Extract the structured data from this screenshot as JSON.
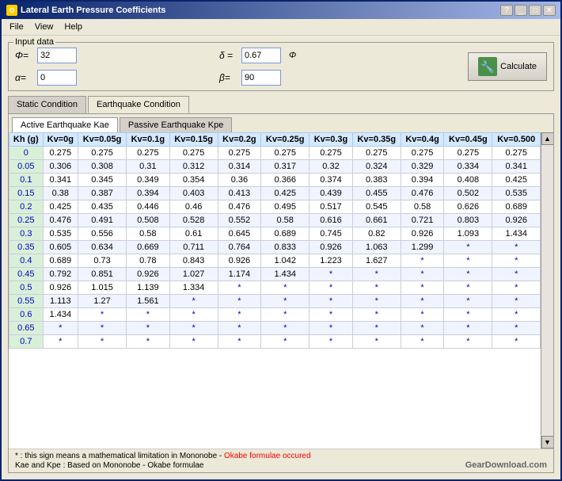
{
  "window": {
    "title": "Lateral Earth Pressure Coefficients",
    "help_btn": "?",
    "close_btn": "✕",
    "minimize_btn": "_",
    "maximize_btn": "□"
  },
  "menubar": {
    "items": [
      "File",
      "View",
      "Help"
    ]
  },
  "input_group": {
    "legend": "Input data",
    "phi_label": "Φ=",
    "phi_value": "32",
    "alpha_label": "α=",
    "alpha_value": "0",
    "delta_label": "δ =",
    "delta_value": "0.67",
    "delta_suffix": "Φ",
    "beta_label": "β=",
    "beta_value": "90",
    "calc_label": "Calculate"
  },
  "tabs_outer": {
    "items": [
      "Static Condition",
      "Earthquake Condition"
    ],
    "active": 1
  },
  "tabs_inner": {
    "items": [
      "Active Earthquake Kae",
      "Passive Earthquake Kpe"
    ],
    "active": 0
  },
  "table": {
    "headers": [
      "Kh (g)",
      "Kv=0g",
      "Kv=0.05g",
      "Kv=0.1g",
      "Kv=0.15g",
      "Kv=0.2g",
      "Kv=0.25g",
      "Kv=0.3g",
      "Kv=0.35g",
      "Kv=0.4g",
      "Kv=0.45g",
      "Kv=0.500"
    ],
    "rows": [
      [
        "0",
        "0.275",
        "0.275",
        "0.275",
        "0.275",
        "0.275",
        "0.275",
        "0.275",
        "0.275",
        "0.275",
        "0.275",
        "0.275"
      ],
      [
        "0.05",
        "0.306",
        "0.308",
        "0.31",
        "0.312",
        "0.314",
        "0.317",
        "0.32",
        "0.324",
        "0.329",
        "0.334",
        "0.341"
      ],
      [
        "0.1",
        "0.341",
        "0.345",
        "0.349",
        "0.354",
        "0.36",
        "0.366",
        "0.374",
        "0.383",
        "0.394",
        "0.408",
        "0.425"
      ],
      [
        "0.15",
        "0.38",
        "0.387",
        "0.394",
        "0.403",
        "0.413",
        "0.425",
        "0.439",
        "0.455",
        "0.476",
        "0.502",
        "0.535"
      ],
      [
        "0.2",
        "0.425",
        "0.435",
        "0.446",
        "0.46",
        "0.476",
        "0.495",
        "0.517",
        "0.545",
        "0.58",
        "0.626",
        "0.689"
      ],
      [
        "0.25",
        "0.476",
        "0.491",
        "0.508",
        "0.528",
        "0.552",
        "0.58",
        "0.616",
        "0.661",
        "0.721",
        "0.803",
        "0.926"
      ],
      [
        "0.3",
        "0.535",
        "0.556",
        "0.58",
        "0.61",
        "0.645",
        "0.689",
        "0.745",
        "0.82",
        "0.926",
        "1.093",
        "1.434"
      ],
      [
        "0.35",
        "0.605",
        "0.634",
        "0.669",
        "0.711",
        "0.764",
        "0.833",
        "0.926",
        "1.063",
        "1.299",
        "*",
        "*"
      ],
      [
        "0.4",
        "0.689",
        "0.73",
        "0.78",
        "0.843",
        "0.926",
        "1.042",
        "1.223",
        "1.627",
        "*",
        "*",
        "*"
      ],
      [
        "0.45",
        "0.792",
        "0.851",
        "0.926",
        "1.027",
        "1.174",
        "1.434",
        "*",
        "*",
        "*",
        "*",
        "*"
      ],
      [
        "0.5",
        "0.926",
        "1.015",
        "1.139",
        "1.334",
        "*",
        "*",
        "*",
        "*",
        "*",
        "*",
        "*"
      ],
      [
        "0.55",
        "1.113",
        "1.27",
        "1.561",
        "*",
        "*",
        "*",
        "*",
        "*",
        "*",
        "*",
        "*"
      ],
      [
        "0.6",
        "1.434",
        "*",
        "*",
        "*",
        "*",
        "*",
        "*",
        "*",
        "*",
        "*",
        "*"
      ],
      [
        "0.65",
        "*",
        "*",
        "*",
        "*",
        "*",
        "*",
        "*",
        "*",
        "*",
        "*",
        "*"
      ],
      [
        "0.7",
        "*",
        "*",
        "*",
        "*",
        "*",
        "*",
        "*",
        "*",
        "*",
        "*",
        "*"
      ]
    ]
  },
  "footer": {
    "line1_prefix": "* : this sign means a mathematical limitation in Mononobe - ",
    "line1_red": "Okabe formulae occured",
    "line2_left": "Kae and Kpe : Based on Mononobe - Okabe formulae",
    "watermark": "GearDownload.com"
  }
}
